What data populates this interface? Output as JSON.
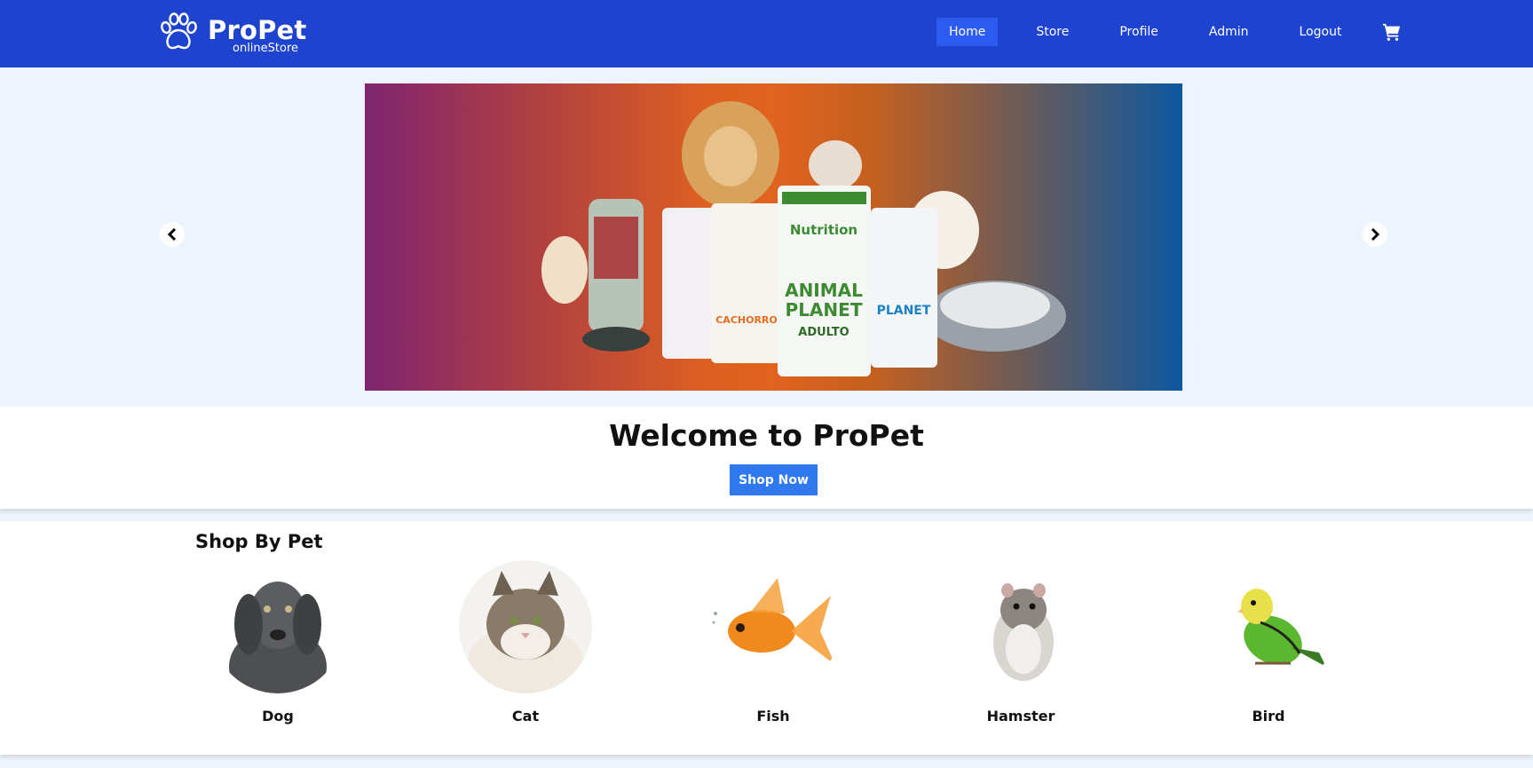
{
  "header": {
    "brand_name": "ProPet",
    "brand_sub": "onlineStore",
    "logo_icon": "paw-icon",
    "nav": [
      {
        "label": "Home",
        "active": true
      },
      {
        "label": "Store",
        "active": false
      },
      {
        "label": "Profile",
        "active": false
      },
      {
        "label": "Admin",
        "active": false
      },
      {
        "label": "Logout",
        "active": false
      }
    ],
    "cart_icon": "cart-icon"
  },
  "carousel": {
    "slide_image": "pet-food-banner",
    "prev_icon": "chevron-left-icon",
    "next_icon": "chevron-right-icon"
  },
  "welcome": {
    "title": "Welcome to ProPet",
    "button_label": "Shop Now"
  },
  "shop_by_pet": {
    "title": "Shop By Pet",
    "pets": [
      {
        "label": "Dog"
      },
      {
        "label": "Cat"
      },
      {
        "label": "Fish"
      },
      {
        "label": "Hamster"
      },
      {
        "label": "Bird"
      }
    ]
  },
  "colors": {
    "navbar": "#1d43cf",
    "nav_active": "#2d5bf0",
    "button": "#2f78ee",
    "page_bg": "#eef4fd"
  }
}
